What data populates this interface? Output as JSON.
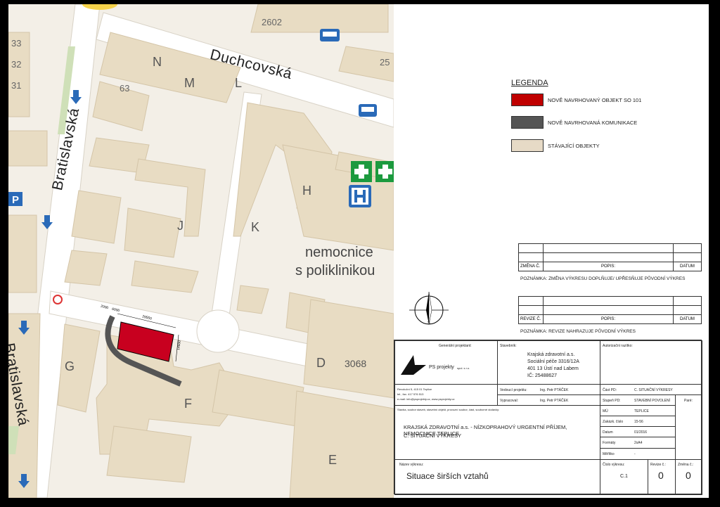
{
  "map": {
    "streets": {
      "top": "Duchcovská",
      "left_upper": "Bratislavská",
      "left_lower": "Bratislavská"
    },
    "building_letters": {
      "N": "N",
      "M": "M",
      "L": "L",
      "H": "H",
      "J": "J",
      "K": "K",
      "G": "G",
      "F": "F",
      "D": "D",
      "E": "E"
    },
    "house_numbers": {
      "n2602": "2602",
      "n63": "63",
      "n3068": "3068",
      "n33": "33",
      "n32": "32",
      "n31": "31",
      "n25": "25"
    },
    "area_name": {
      "line1": "nemocnice",
      "line2": "s poliklinikou"
    },
    "dims": {
      "d1": "2000",
      "d2": "6000",
      "d3": "29550",
      "d4": "14600"
    },
    "icons": {
      "bus": "bus-icon",
      "pharmacy": "pharmacy-cross-icon",
      "hospital": "hospital-h-icon",
      "parking": "parking-icon",
      "arrow": "arrow-down-icon"
    },
    "colors": {
      "new_object": "#c8001f",
      "road": "#555555",
      "existing": "#e8d9bd"
    }
  },
  "legend": {
    "title": "LEGENDA",
    "items": [
      {
        "label": "NOVĚ NAVRHOVANÝ OBJEKT SO 101",
        "color": "#c00000"
      },
      {
        "label": "NOVĚ NAVRHOVANÁ KOMUNIKACE",
        "color": "#555555"
      },
      {
        "label": "STÁVAJÍCÍ OBJEKTY",
        "color": "#e6dac6"
      }
    ]
  },
  "changes": {
    "col1": "ZMĚNA Č.",
    "col2": "POPIS:",
    "col3": "DATUM",
    "note": "POZNÁMKA: ZMĚNA VÝKRESU DOPLŇUJE/ UPŘESŇUJE PŮVODNÍ VÝKRES"
  },
  "revisions": {
    "col1": "REVIZE Č.",
    "col2": "POPIS:",
    "col3": "DATUM",
    "note": "POZNÁMKA: REVIZE NAHRAZUJE PŮVODNÍ VÝKRES"
  },
  "north_label": "S",
  "title_block": {
    "gen_designer_label": "Generální projektant:",
    "company": "PS projekty",
    "company_suffix": "spol. s r.o.",
    "investor_label": "Stavebník:",
    "investor_lines": [
      "Krajská zdravotní a.s.",
      "Sociální péče 3316/12A",
      "401 13 Ústí nad Labem",
      "IČ: 25488627"
    ],
    "auth_label": "Autorizační razítko:",
    "address_lines": [
      "Revoluční 5, 415 01 Teplice",
      "tel., fax. 417 576 513",
      "e-mail: info@psprojekty.cz, www.psprojekty.cz"
    ],
    "lead_label": "Vedoucí projektu:",
    "lead_name": "Ing. Petr PTÁČEK",
    "drawn_label": "Vypracoval:",
    "drawn_name": "Ing. Petr PTÁČEK",
    "part_label": "Část PD:",
    "part_value": "C. SITUAČNÍ VÝKRESY",
    "stage_label": "Stupeň PD:",
    "stage_value": "STAVEBNÍ POVOLENÍ",
    "copies_label": "Paré:",
    "project_header": "Stavba, soubor staveb, stavební objekt, provozní soubor, část, souborné dodávky:",
    "project_line1": "KRAJSKÁ ZDRAVOTNÍ a.s. - NÍZKOPRAHOVÝ URGENTNÍ PŘÍJEM, NEMOCNICE TEPLICE",
    "project_line2": "C. SITUAČNÍ VÝKRESY",
    "rows": [
      {
        "label": "MÚ",
        "value": "TEPLICE"
      },
      {
        "label": "Zakázk. číslo",
        "value": "15-56"
      },
      {
        "label": "Datum",
        "value": "01/2016"
      },
      {
        "label": "Formáty",
        "value": "2xA4"
      },
      {
        "label": "Měřítko",
        "value": "-"
      }
    ],
    "drawing_title_label": "Název výkresu:",
    "drawing_title": "Situace širších vztahů",
    "drawing_no_label": "Číslo výkresu:",
    "drawing_no": "C.1",
    "rev_label": "Revize č.:",
    "rev_value": "0",
    "change_label": "Změna č.:",
    "change_value": "0"
  }
}
